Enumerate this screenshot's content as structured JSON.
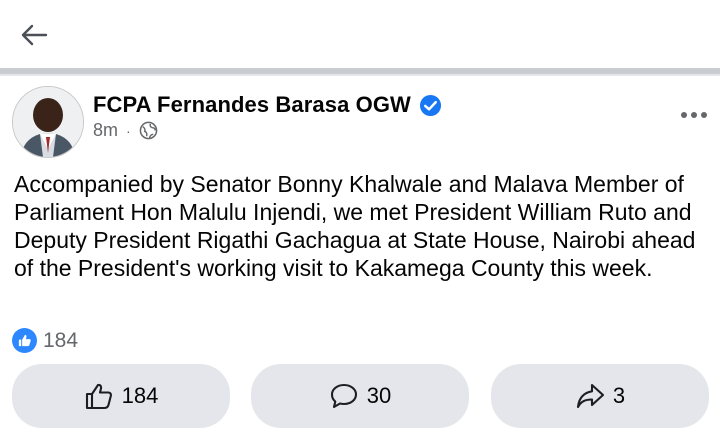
{
  "post": {
    "author_name": "FCPA Fernandes Barasa OGW",
    "timestamp": "8m",
    "separator": "·",
    "privacy_icon": "globe-icon",
    "text": "Accompanied by Senator Bonny Khalwale and Malava Member of Parliament Hon Malulu Injendi, we met President William Ruto and Deputy President Rigathi Gachagua at State House, Nairobi ahead of the President's working visit to Kakamega County this week."
  },
  "reactions": {
    "count": "184",
    "icon": "thumbs-up-icon",
    "color": "#2d88ff"
  },
  "actions": {
    "like_count": "184",
    "comment_count": "30",
    "share_count": "3"
  },
  "colors": {
    "verified_badge": "#1877f2",
    "button_bg": "#e4e6eb",
    "meta_text": "#65676b"
  }
}
